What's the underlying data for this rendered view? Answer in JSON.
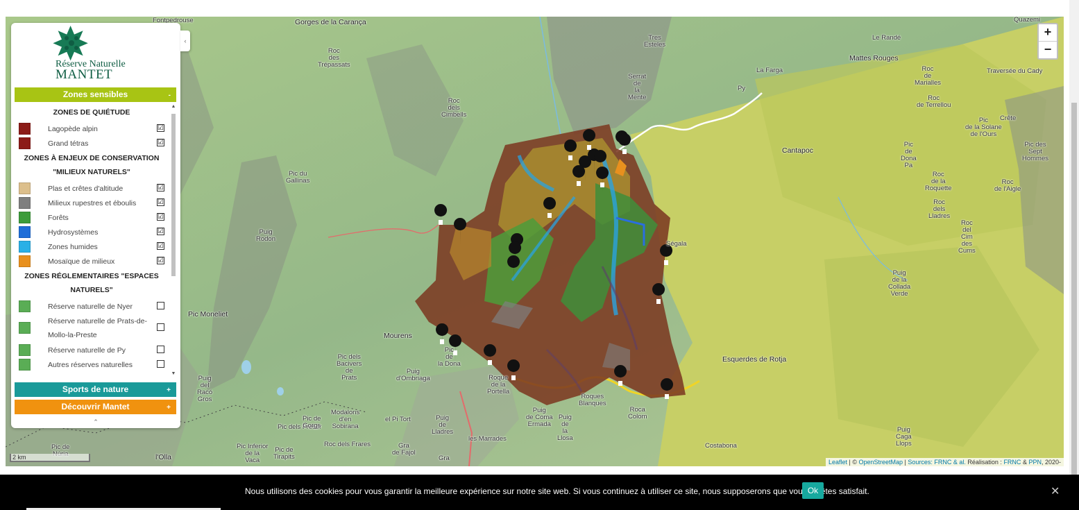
{
  "app": {
    "title": "Réserve Naturelle MANTET"
  },
  "logo": {
    "line1": "Réserve Naturelle",
    "line2": "MANTET"
  },
  "panel": {
    "collapse_icon": "‹",
    "categories": [
      {
        "label": "Zones sensibles",
        "toggle": "-",
        "color": "#a8c414"
      },
      {
        "label": "Sports de nature",
        "toggle": "+",
        "color": "#1a9a99"
      },
      {
        "label": "Découvrir Mantet",
        "toggle": "+",
        "color": "#f0920f"
      }
    ],
    "groups": {
      "quietude": {
        "title": "ZONES DE QUIÉTUDE",
        "items": [
          {
            "label": "Lagopède alpin",
            "color": "#8c1c18",
            "checked": "☑"
          },
          {
            "label": "Grand tétras",
            "color": "#8c1c18",
            "checked": "☑"
          }
        ]
      },
      "conservation": {
        "title": "ZONES À ENJEUX DE CONSERVATION \"MILIEUX NATURELS\"",
        "items": [
          {
            "label": "Plas et crêtes d'altitude",
            "color": "#dcbf8c",
            "checked": "☑"
          },
          {
            "label": "Milieux rupestres et éboulis",
            "color": "#7f7f7f",
            "checked": "☑"
          },
          {
            "label": "Forêts",
            "color": "#3c9c3a",
            "checked": "☑"
          },
          {
            "label": "Hydrosystèmes",
            "color": "#1f6ed8",
            "checked": "☑"
          },
          {
            "label": "Zones humides",
            "color": "#2ab0e6",
            "checked": "☑"
          },
          {
            "label": "Mosaïque de milieux",
            "color": "#e8901e",
            "checked": "☑"
          }
        ]
      },
      "reglementaires": {
        "title": "ZONES RÉGLEMENTAIRES \"ESPACES NATURELS\"",
        "items": [
          {
            "label": "Réserve naturelle de Nyer",
            "color": "#5aad55",
            "checked": ""
          },
          {
            "label": "Réserve naturelle de Prats-de-Mollo-la-Preste",
            "color": "#5aad55",
            "checked": ""
          },
          {
            "label": "Réserve naturelle de Py",
            "color": "#5aad55",
            "checked": ""
          },
          {
            "label": "Autres réserves naturelles",
            "color": "#5aad55",
            "checked": ""
          }
        ]
      }
    },
    "collapse_bottom": "⌃"
  },
  "map": {
    "zoom_in": "+",
    "zoom_out": "−",
    "scale": "2 km",
    "attribution": {
      "leaflet": "Leaflet",
      "sep1": " | © ",
      "osm": "OpenStreetMap",
      "sep2": " | ",
      "sources": "Sources: FRNC & al.",
      "realisation": " Réalisation : ",
      "frnc": "FRNC",
      "amp": " & ",
      "ppn": "PPN",
      "year": ", 2020-"
    },
    "places": [
      {
        "name": "Fontpedrouse"
      },
      {
        "name": "Gorges de la Carança"
      },
      {
        "name": "Roc\ndes\nTrépassats"
      },
      {
        "name": "Tres\nEsteles"
      },
      {
        "name": "Serrat\nde\nla\nMente"
      },
      {
        "name": "Roc\ndels\nCimbells"
      },
      {
        "name": "Pic du\nGallinas"
      },
      {
        "name": "Puig\nRodon"
      },
      {
        "name": "Pic Moneliet"
      },
      {
        "name": "Mourens"
      },
      {
        "name": "Pic\nde\nla Dona"
      },
      {
        "name": "Pic dels\nBacivers\nde\nPrats"
      },
      {
        "name": "Puig\nd'Ombriaga"
      },
      {
        "name": "Roque\nde la\nPortella"
      },
      {
        "name": "Puig\nde Coma\nErmada"
      },
      {
        "name": "Puig\nde\nla\nLlosa"
      },
      {
        "name": "Roques\nBlanques"
      },
      {
        "name": "Roca\nColom"
      },
      {
        "name": "Esquerdes de Rotja"
      },
      {
        "name": "Ségala"
      },
      {
        "name": "Cantapoc"
      },
      {
        "name": "Le Randé"
      },
      {
        "name": "Mattes Rouges"
      },
      {
        "name": "La Farga"
      },
      {
        "name": "Py"
      },
      {
        "name": "Roc\nde\nMarialles"
      },
      {
        "name": "Traversée du Cady"
      },
      {
        "name": "Roc\nde Terrellou"
      },
      {
        "name": "Pic\nde la Solane\nde l'Ours"
      },
      {
        "name": "Crête"
      },
      {
        "name": "Pic des\nSept\nHommes"
      },
      {
        "name": "Pic\nde\nDona\nPa"
      },
      {
        "name": "Roc\nde la\nRoquette"
      },
      {
        "name": "Roc\nde l'Aigle"
      },
      {
        "name": "Roc\ndels\nLladres"
      },
      {
        "name": "Roc\ndel\nCim\ndes\nCums"
      },
      {
        "name": "Puig\nde la\nCollada\nVerde"
      },
      {
        "name": "Puig\nCaga\nLlops"
      },
      {
        "name": "Costabona"
      },
      {
        "name": "Puig\ndel\nRacó\nGros"
      },
      {
        "name": "Pic dels Freser"
      },
      {
        "name": "Pic de\nGorgs"
      },
      {
        "name": "Modalons\nd'en\nSobirana"
      },
      {
        "name": "el Pi Tort"
      },
      {
        "name": "Puig\nde\nLladres"
      },
      {
        "name": "les Marrades"
      },
      {
        "name": "Roc dels Frares"
      },
      {
        "name": "Pic Inferior\nde la\nVaca"
      },
      {
        "name": "Pic de\nTirapits"
      },
      {
        "name": "Pic de\nNúria"
      },
      {
        "name": "l'Olla"
      },
      {
        "name": "Gra\nde Fajol"
      },
      {
        "name": "Gra"
      },
      {
        "name": "Quazemi"
      }
    ]
  },
  "cookie": {
    "message": "Nous utilisons des cookies pour vous garantir la meilleure expérience sur notre site web. Si vous continuez à utiliser ce site, nous supposerons que vous en êtes satisfait.",
    "ok": "Ok",
    "close": "✕"
  }
}
